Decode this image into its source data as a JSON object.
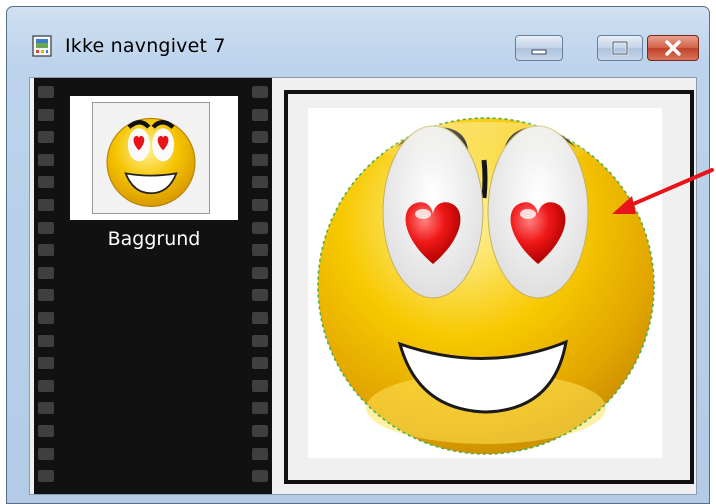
{
  "window": {
    "title": "Ikke navngivet 7",
    "icons": {
      "app": "image-document-icon",
      "minimize": "minimize-icon",
      "maximize": "maximize-icon",
      "close": "close-icon"
    }
  },
  "layers": {
    "items": [
      {
        "label": "Baggrund",
        "thumbnail": "smiley-heart-eyes-thumbnail"
      }
    ]
  },
  "canvas": {
    "image": "smiley-heart-eyes",
    "selection": "circular-marquee"
  },
  "colors": {
    "annotation_arrow": "#e8141a",
    "selection_outline": "#4caf50",
    "smiley_yellow": "#f5c400",
    "heart_red": "#e8141a",
    "filmstrip": "#111111"
  }
}
